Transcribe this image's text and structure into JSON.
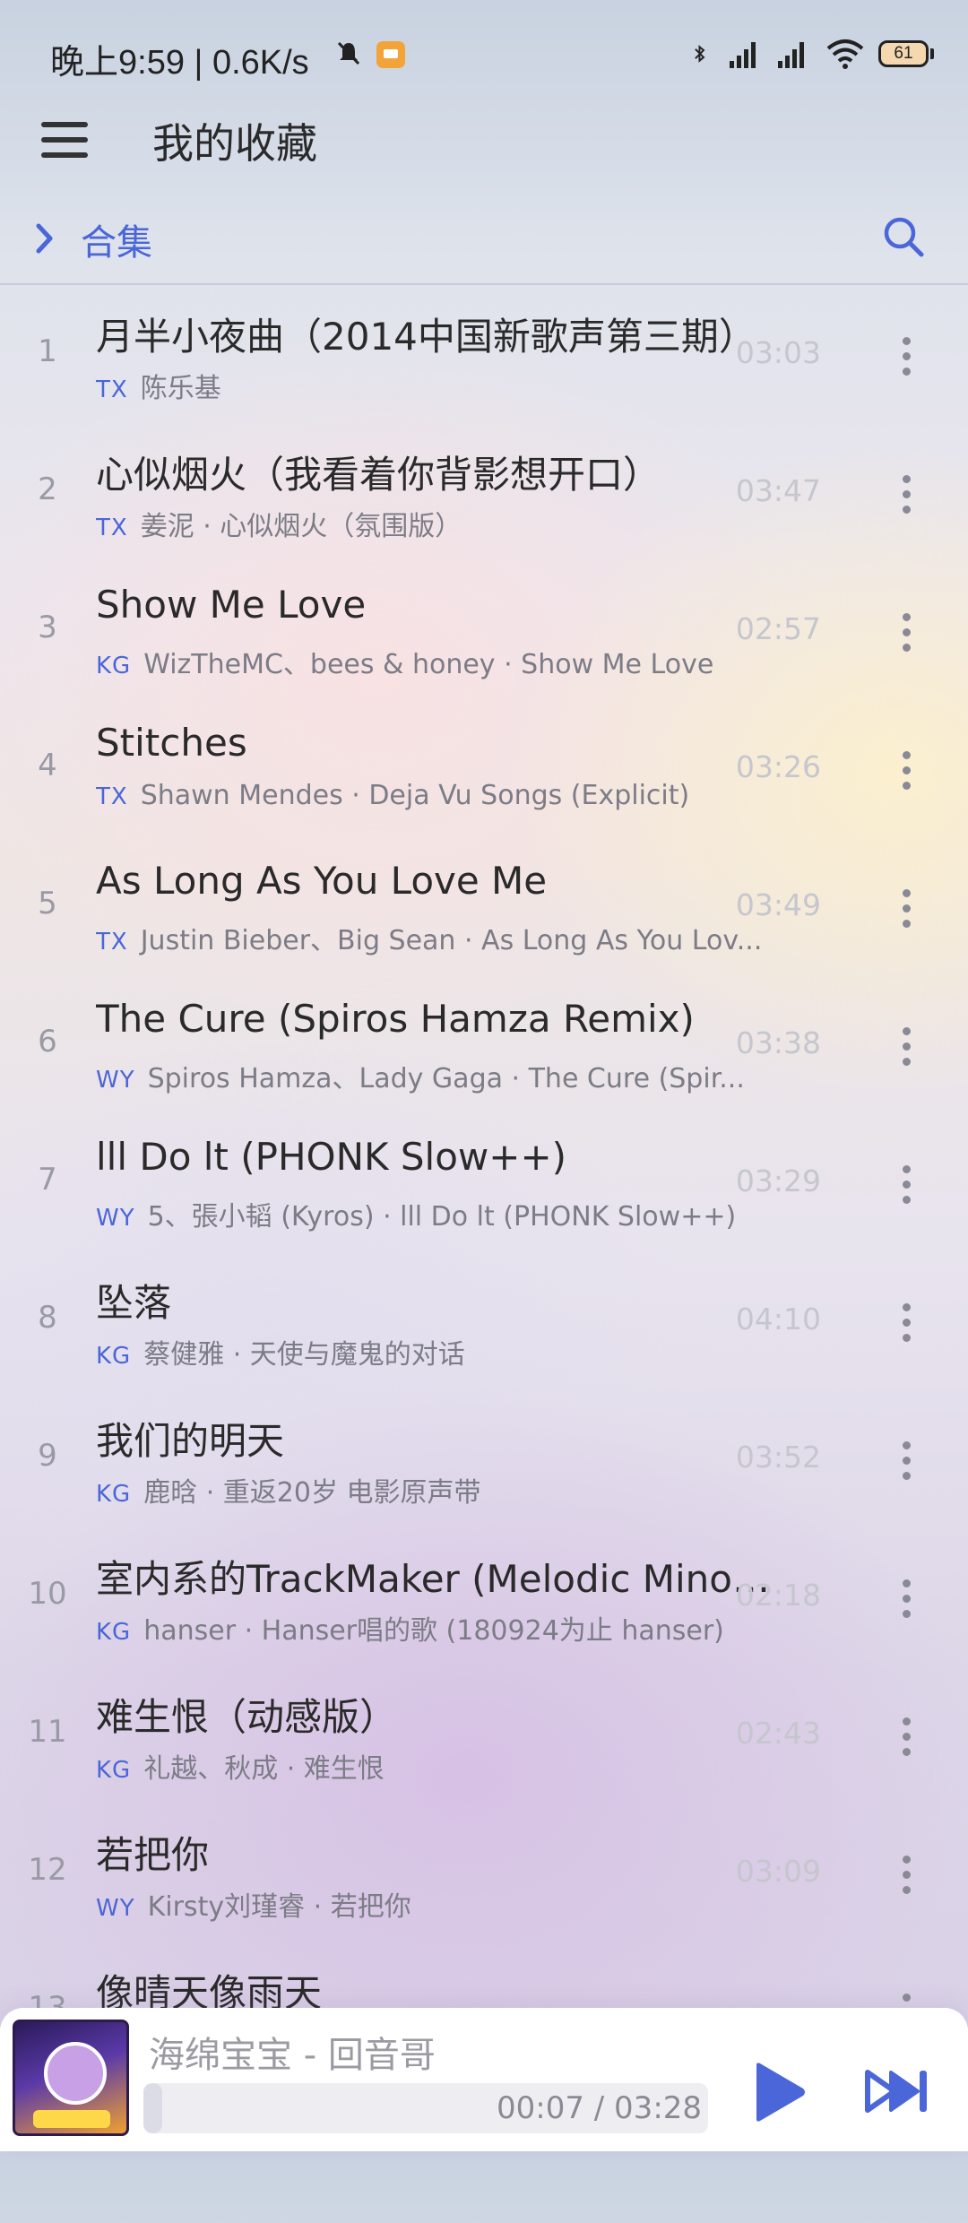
{
  "status_bar": {
    "time": "晚上9:59 | 0.6K/s",
    "battery": "61"
  },
  "app_bar": {
    "title": "我的收藏"
  },
  "collection": {
    "label": "合集"
  },
  "songs": [
    {
      "index": "1",
      "title": "月半小夜曲（2014中国新歌声第三期）",
      "source": "TX",
      "subtitle": "陈乐基",
      "duration": "03:03"
    },
    {
      "index": "2",
      "title": "心似烟火（我看着你背影想开口）",
      "source": "TX",
      "subtitle": "姜泥 · 心似烟火（氛围版）",
      "duration": "03:47"
    },
    {
      "index": "3",
      "title": "Show Me Love",
      "source": "KG",
      "subtitle": "WizTheMC、bees & honey · Show Me Love",
      "duration": "02:57"
    },
    {
      "index": "4",
      "title": "Stitches",
      "source": "TX",
      "subtitle": "Shawn Mendes · Deja Vu Songs (Explicit)",
      "duration": "03:26"
    },
    {
      "index": "5",
      "title": "As Long As You Love Me",
      "source": "TX",
      "subtitle": "Justin Bieber、Big Sean · As Long As You Lov...",
      "duration": "03:49"
    },
    {
      "index": "6",
      "title": "The Cure (Spiros Hamza Remix)",
      "source": "WY",
      "subtitle": "Spiros Hamza、Lady Gaga · The Cure (Spir...",
      "duration": "03:38"
    },
    {
      "index": "7",
      "title": "lll Do lt (PHONK Slow++)",
      "source": "WY",
      "subtitle": "5、張小韬 (Kyros) · lll Do lt (PHONK Slow++)",
      "duration": "03:29"
    },
    {
      "index": "8",
      "title": "坠落",
      "source": "KG",
      "subtitle": "蔡健雅 · 天使与魔鬼的对话",
      "duration": "04:10"
    },
    {
      "index": "9",
      "title": "我们的明天",
      "source": "KG",
      "subtitle": "鹿晗 · 重返20岁 电影原声带",
      "duration": "03:52"
    },
    {
      "index": "10",
      "title": "室内系的TrackMaker (Melodic Minor...",
      "source": "KG",
      "subtitle": "hanser · Hanser唱的歌 (180924为止 hanser)",
      "duration": "02:18"
    },
    {
      "index": "11",
      "title": "难生恨（动感版）",
      "source": "KG",
      "subtitle": "礼越、秋成 · 难生恨",
      "duration": "02:43"
    },
    {
      "index": "12",
      "title": "若把你",
      "source": "WY",
      "subtitle": "Kirsty刘瑾睿 · 若把你",
      "duration": "03:09"
    },
    {
      "index": "13",
      "title": "像晴天像雨天",
      "source": "",
      "subtitle": "",
      "duration": ""
    }
  ],
  "player": {
    "title": "海绵宝宝 - 回音哥",
    "time": "00:07 / 03:28",
    "progress": 0.034,
    "cover_label": "回音哥"
  },
  "colors": {
    "accent": "#4a66d8",
    "text": "#2a2a2a",
    "muted": "#7c7c86"
  }
}
